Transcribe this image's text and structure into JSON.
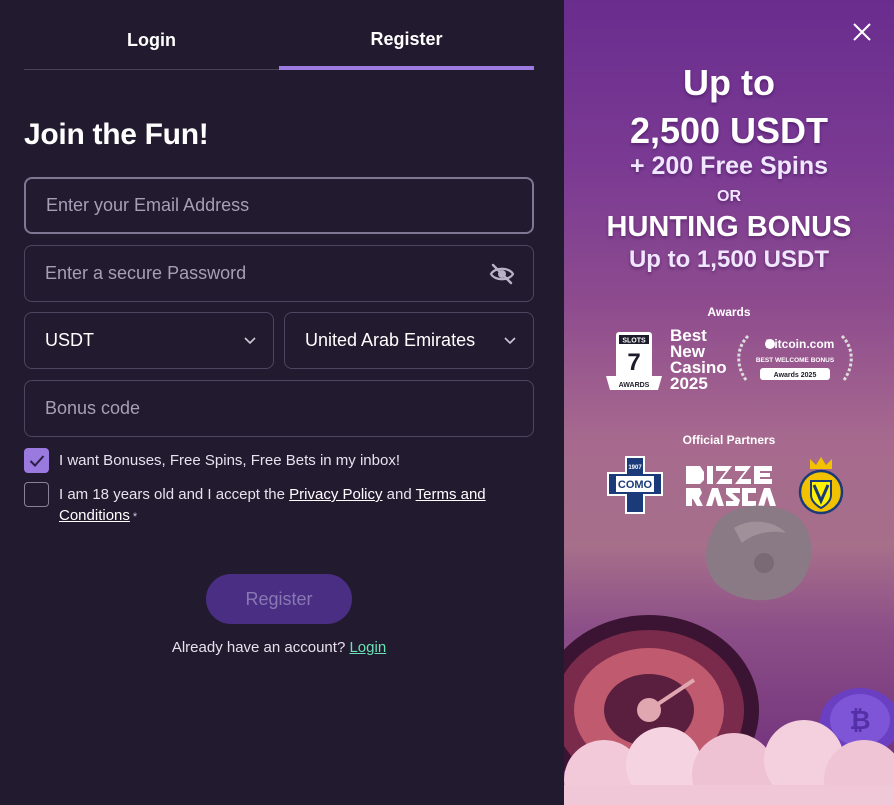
{
  "tabs": {
    "login": "Login",
    "register": "Register"
  },
  "form": {
    "title": "Join the Fun!",
    "email_placeholder": "Enter your Email Address",
    "password_placeholder": "Enter a secure Password",
    "currency": "USDT",
    "country": "United Arab Emirates",
    "bonus_placeholder": "Bonus code",
    "bonuses_checkbox": {
      "label": "I want Bonuses, Free Spins, Free Bets in my inbox!",
      "checked": true
    },
    "terms_checkbox": {
      "prefix": "I am 18 years old and I accept the",
      "privacy": "Privacy Policy",
      "and": "and",
      "terms": "Terms and Conditions",
      "required": "*",
      "checked": false
    },
    "register_button": "Register",
    "already_text": "Already have an account?",
    "login_link": "Login"
  },
  "promo": {
    "line1": "Up to",
    "line2": "2,500 USDT",
    "line3": "+ 200 Free Spins",
    "line4": "OR",
    "line5": "HUNTING BONUS",
    "line6": "Up to 1,500 USDT",
    "awards_label": "Awards",
    "award1": {
      "brand": "SLOTS",
      "num": "7",
      "ribbon": "AWARDS",
      "text_lines": [
        "Best",
        "New",
        "Casino",
        "2025"
      ]
    },
    "award2": {
      "brand": "Bitcoin.com",
      "line": "BEST WELCOME BONUS",
      "ribbon": "Awards 2025"
    },
    "partners_label": "Official Partners",
    "partner_como": "COMO",
    "partner_como_year": "1907"
  },
  "icons": [
    "eye-off-icon",
    "chevron-down-icon",
    "checkmark-icon",
    "close-icon"
  ],
  "colors": {
    "accent": "#9c7ae0",
    "link": "#6be3b7",
    "background": "#221a2e",
    "register_btn": "#4a2e84"
  }
}
